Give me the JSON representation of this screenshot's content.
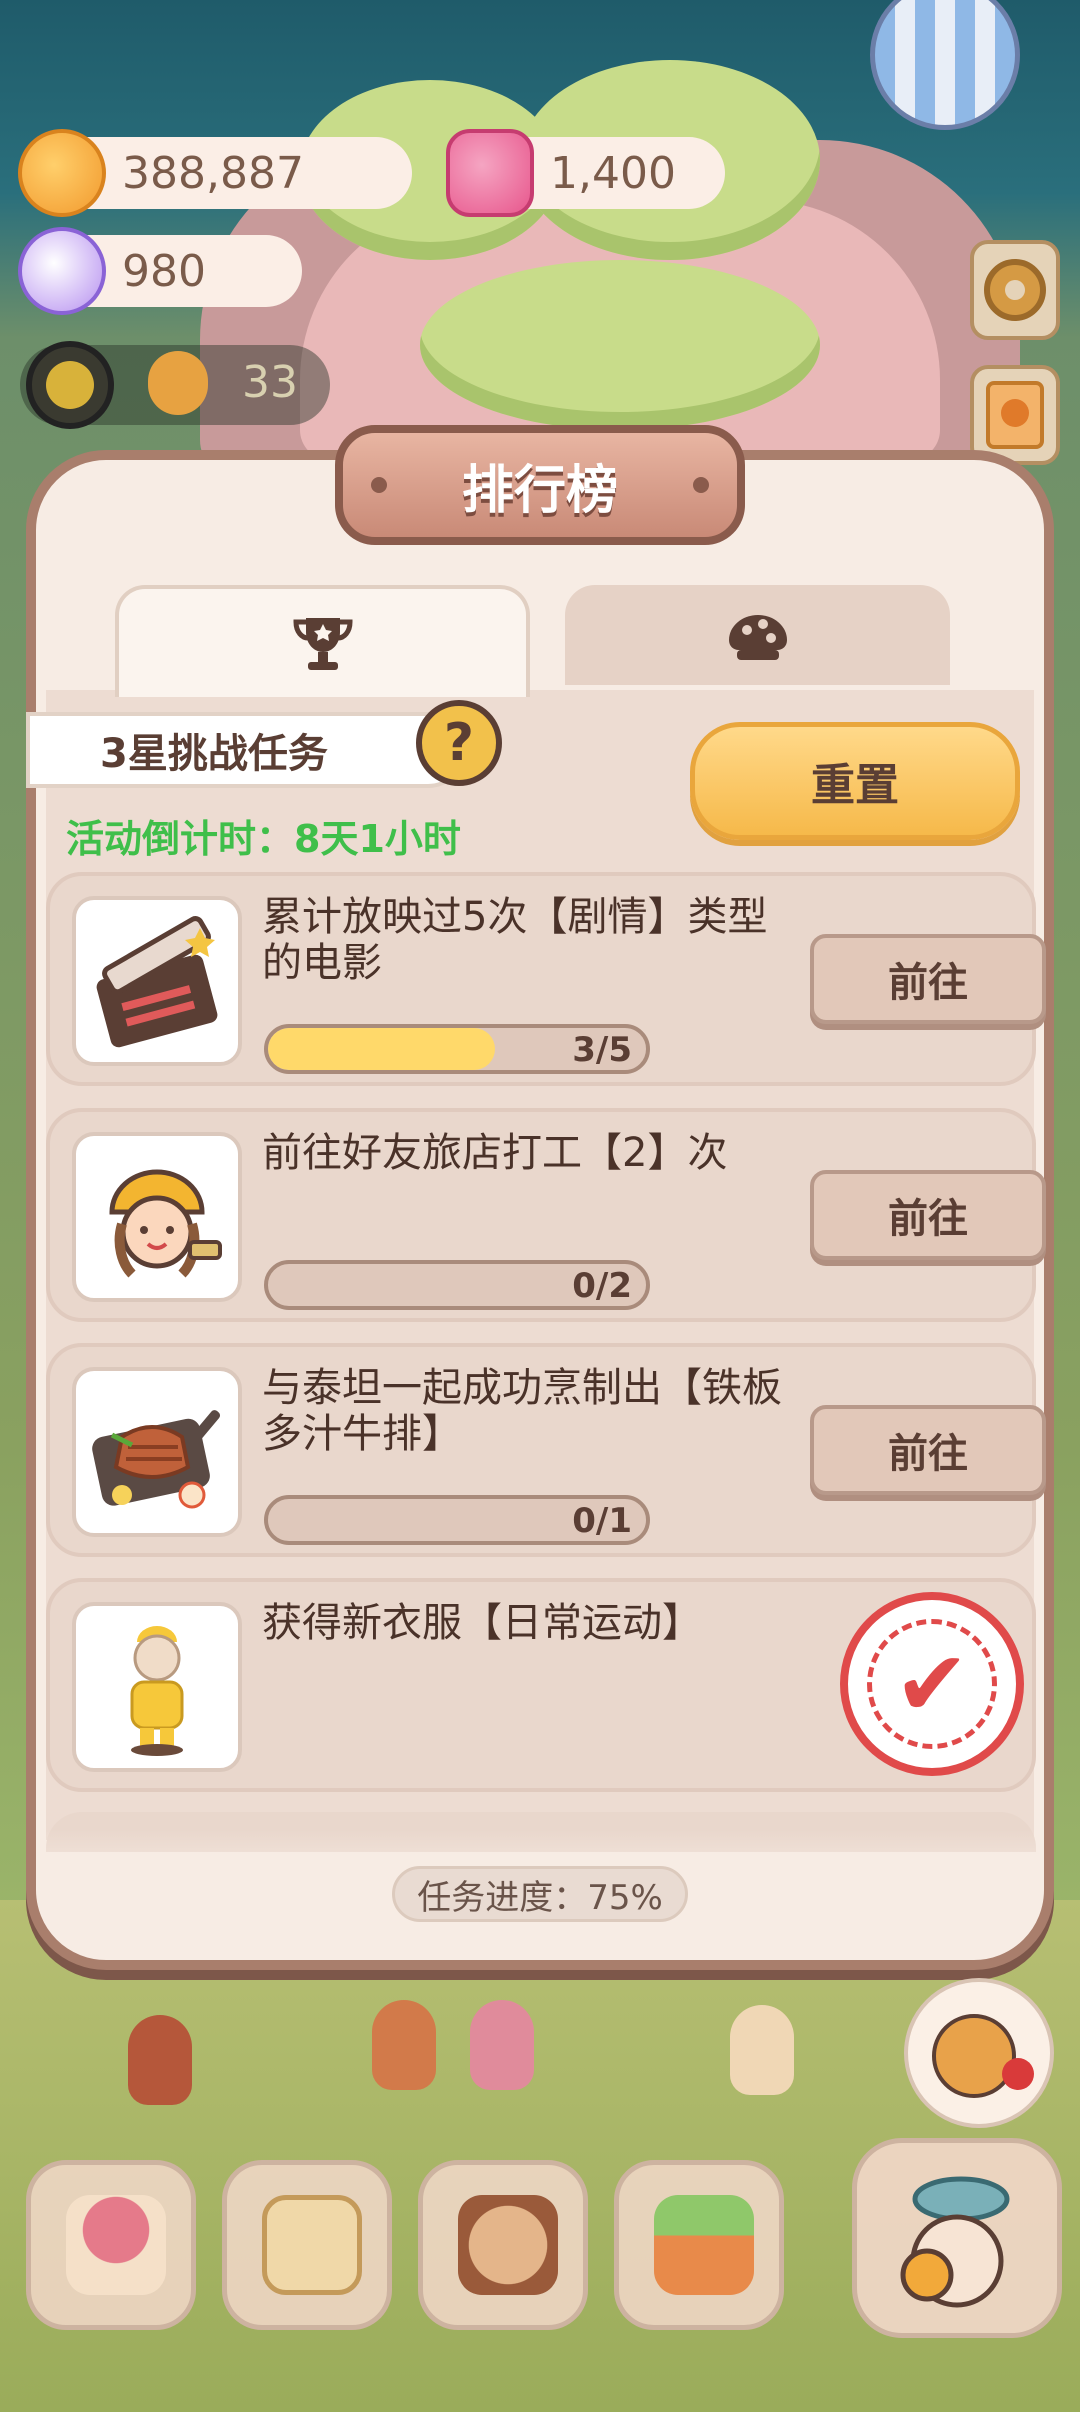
{
  "currencies": {
    "coins": "388,887",
    "gems": "1,400",
    "crystals": "980"
  },
  "level": {
    "value": "33"
  },
  "panel": {
    "title": "排行榜",
    "tabs": [
      {
        "icon": "trophy-icon",
        "active": true
      },
      {
        "icon": "cookie-icon",
        "active": false
      }
    ],
    "task_type": "3星挑战任务",
    "help_label": "?",
    "countdown": "活动倒计时：8天1小时",
    "reset_label": "重置",
    "tasks": [
      {
        "icon": "clapperboard-icon",
        "description": "累计放映过5次【剧情】类型的电影",
        "progress_text": "3/5",
        "progress": 0.6,
        "action": "前往"
      },
      {
        "icon": "worker-girl-icon",
        "description": "前往好友旅店打工【2】次",
        "progress_text": "0/2",
        "progress": 0,
        "action": "前往"
      },
      {
        "icon": "steak-icon",
        "description": "与泰坦一起成功烹制出【铁板多汁牛排】",
        "progress_text": "0/1",
        "progress": 0,
        "action": "前往"
      },
      {
        "icon": "outfit-icon",
        "description": "获得新衣服【日常运动】",
        "completed": true
      }
    ],
    "overall_progress": "任务进度：75%"
  },
  "colors": {
    "accent": "#f6b94a",
    "countdown": "#3fbf4a",
    "panel_border": "#a97e6c",
    "stamp": "#e04a4a"
  }
}
